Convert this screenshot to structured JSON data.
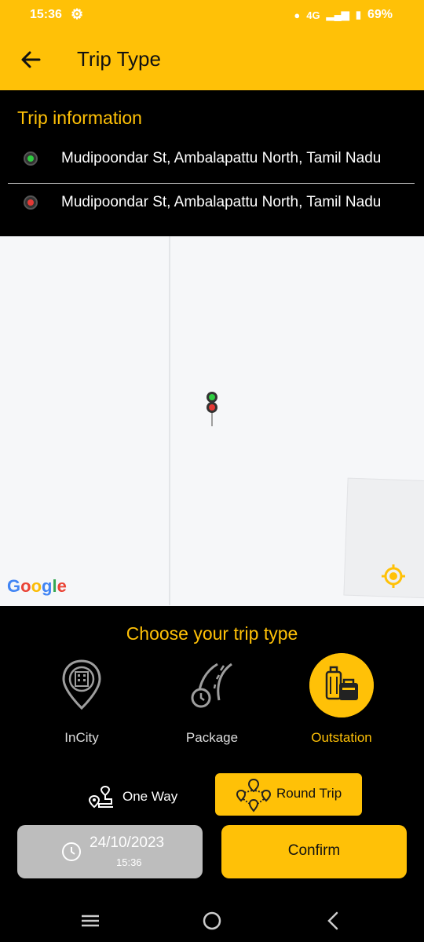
{
  "status": {
    "time": "15:36",
    "network": "4G",
    "battery": "69%"
  },
  "header": {
    "title": "Trip Type"
  },
  "trip_info": {
    "heading": "Trip information",
    "pickup": "Mudipoondar St, Ambalapattu North, Tamil Nadu",
    "drop": "Mudipoondar St, Ambalapattu North, Tamil Nadu"
  },
  "map": {
    "attribution": "Google"
  },
  "trip_types": {
    "heading": "Choose your trip type",
    "options": [
      {
        "label": "InCity",
        "icon": "building-pin-icon",
        "active": false
      },
      {
        "label": "Package",
        "icon": "road-clock-icon",
        "active": false
      },
      {
        "label": "Outstation",
        "icon": "luggage-icon",
        "active": true
      }
    ]
  },
  "trip_mode": {
    "one_way": {
      "label": "One Way",
      "icon": "route-pins-icon"
    },
    "round_trip": {
      "label": "Round Trip",
      "icon": "multi-pin-route-icon",
      "selected": true
    }
  },
  "schedule": {
    "date": "24/10/2023",
    "time": "15:36"
  },
  "actions": {
    "confirm": "Confirm"
  },
  "colors": {
    "accent": "#FFC107",
    "background": "#000000",
    "pickup": "#2ECC40",
    "drop": "#E53935"
  }
}
